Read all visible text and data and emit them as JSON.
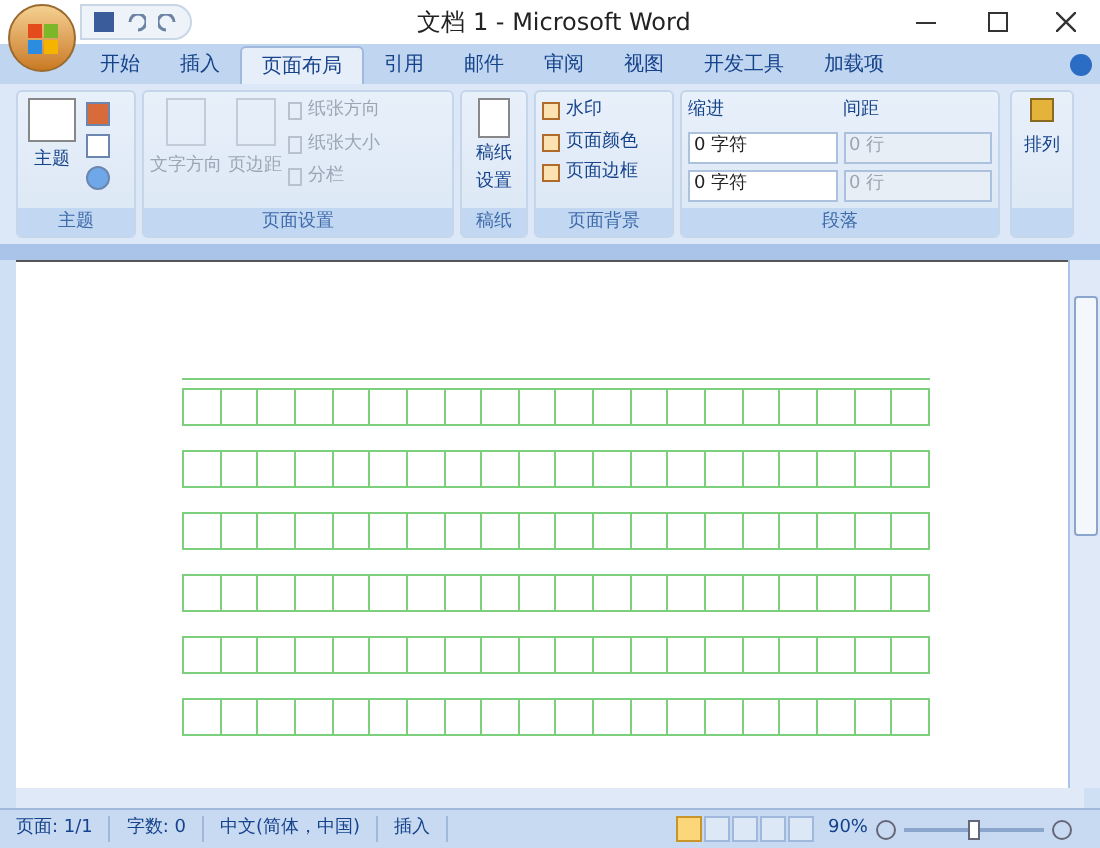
{
  "window": {
    "title": "文档 1 - Microsoft Word"
  },
  "tabs": [
    {
      "label": "开始",
      "selected": false
    },
    {
      "label": "插入",
      "selected": false
    },
    {
      "label": "页面布局",
      "selected": true
    },
    {
      "label": "引用",
      "selected": false
    },
    {
      "label": "邮件",
      "selected": false
    },
    {
      "label": "审阅",
      "selected": false
    },
    {
      "label": "视图",
      "selected": false
    },
    {
      "label": "开发工具",
      "selected": false
    },
    {
      "label": "加载项",
      "selected": false
    }
  ],
  "ribbon": {
    "theme": {
      "label": "主题",
      "button": "主题"
    },
    "page_setup": {
      "label": "页面设置",
      "large": [
        {
          "label": "文字方向",
          "disabled": true
        },
        {
          "label": "页边距",
          "disabled": true
        }
      ],
      "small": [
        {
          "label": "纸张方向",
          "disabled": true
        },
        {
          "label": "纸张大小",
          "disabled": true
        },
        {
          "label": "分栏",
          "disabled": true
        }
      ]
    },
    "grid_paper": {
      "label": "稿纸",
      "button": [
        "稿纸",
        "设置"
      ]
    },
    "page_background": {
      "label": "页面背景",
      "items": [
        {
          "label": "水印"
        },
        {
          "label": "页面颜色"
        },
        {
          "label": "页面边框"
        }
      ]
    },
    "paragraph": {
      "label": "段落",
      "indent": {
        "title": "缩进",
        "fields": [
          {
            "value": "0 字符",
            "disabled": false
          },
          {
            "value": "0 字符",
            "disabled": false
          }
        ]
      },
      "spacing": {
        "title": "间距",
        "fields": [
          {
            "value": "0 行",
            "disabled": true
          },
          {
            "value": "0 行",
            "disabled": true
          }
        ]
      }
    },
    "arrange": {
      "label": "排列"
    }
  },
  "status_bar": {
    "items": [
      "页面: 1/1",
      "字数: 0",
      "中文(简体，中国)",
      "插入"
    ],
    "views": [
      {
        "selected": true
      },
      {
        "selected": false
      },
      {
        "selected": false
      },
      {
        "selected": false
      },
      {
        "selected": false
      }
    ],
    "zoom": "90%",
    "zoom_level": {
      "level": 0.5
    }
  }
}
